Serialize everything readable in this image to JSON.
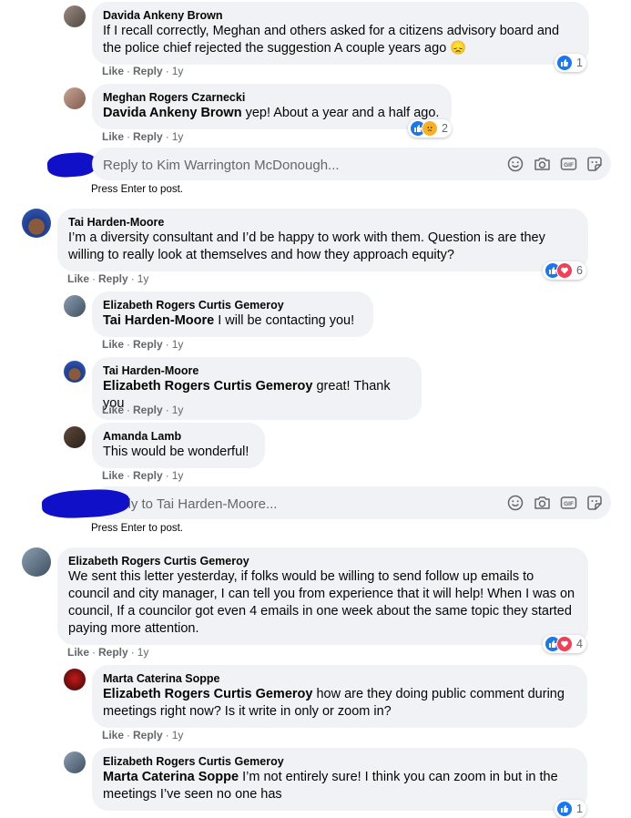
{
  "actions": {
    "like": "Like",
    "reply": "Reply",
    "dot": "·"
  },
  "hint": "Press Enter to post.",
  "c1": {
    "name": "Davida Ankeny Brown",
    "text": "If I recall correctly, Meghan and others asked for a citizens advisory board and the police chief rejected the suggestion A couple years ago 😞",
    "time": "1y",
    "reactions": "1"
  },
  "c2": {
    "name": "Meghan Rogers Czarnecki",
    "mention": "Davida Ankeny Brown",
    "text": " yep! About a year and a half ago.",
    "time": "1y",
    "reactions": "2"
  },
  "reply1": {
    "placeholder": "Reply to Kim Warrington McDonough..."
  },
  "c3": {
    "name": "Tai Harden-Moore",
    "text": "I’m a diversity consultant and I’d be happy to work with them. Question is are they willing to really look at themselves and how they approach equity?",
    "time": "1y",
    "reactions": "6"
  },
  "c4": {
    "name": "Elizabeth Rogers Curtis Gemeroy",
    "mention": "Tai Harden-Moore",
    "text": " I will be contacting you!",
    "time": "1y"
  },
  "c5": {
    "name": "Tai Harden-Moore",
    "mention": "Elizabeth Rogers Curtis Gemeroy",
    "text": " great! Thank you",
    "time": "1y"
  },
  "c6": {
    "name": "Amanda Lamb",
    "text": "This would be wonderful!",
    "time": "1y"
  },
  "reply2": {
    "placeholder": "Reply to Tai Harden-Moore..."
  },
  "c7": {
    "name": "Elizabeth Rogers Curtis Gemeroy",
    "text": "We sent this letter yesterday, if folks would be willing to send follow up emails to council and city manager, I can tell you from experience that it will help! When I was on council, If a councilor got even 4 emails in one week about the same topic they started paying more attention.",
    "time": "1y",
    "reactions": "4"
  },
  "c8": {
    "name": "Marta Caterina Soppe",
    "mention": "Elizabeth Rogers Curtis Gemeroy",
    "text": " how are they doing public comment during meetings right now? Is it write in only or zoom in?",
    "time": "1y"
  },
  "c9": {
    "name": "Elizabeth Rogers Curtis Gemeroy",
    "mention": "Marta Caterina Soppe",
    "text": " I’m not entirely sure! I think you can zoom in but in the meetings I’ve seen no one has",
    "reactions": "1"
  },
  "colors": {
    "like": "#1877f2",
    "love": "#f33e58",
    "sad": "#f7b125",
    "bubble": "#f0f2f5",
    "meta": "#65676b"
  },
  "icons": {
    "reply_box": [
      "emoji-icon",
      "camera-icon",
      "gif-icon",
      "sticker-icon"
    ]
  }
}
